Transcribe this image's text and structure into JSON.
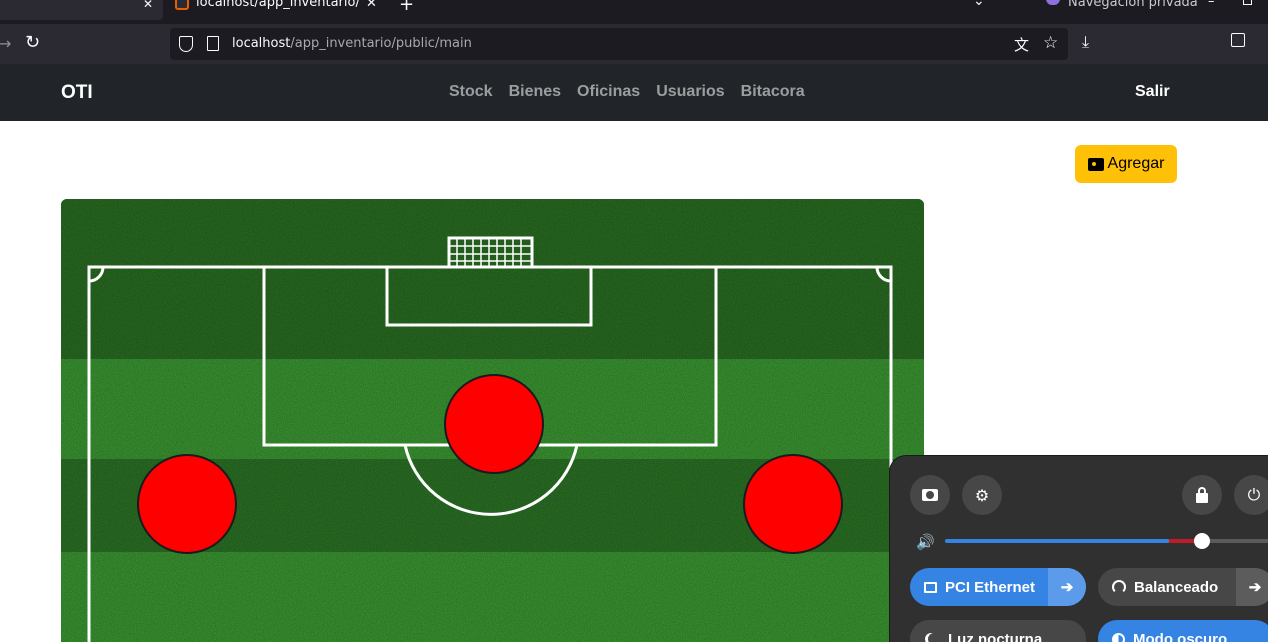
{
  "browser": {
    "tab_active_title": "localhost/app_inventario/public/main",
    "private_label": "Navegación privada",
    "url_host": "localhost",
    "url_path": "/app_inventario/public/main"
  },
  "site": {
    "brand": "OTI",
    "menu": [
      {
        "label": "Stock"
      },
      {
        "label": "Bienes"
      },
      {
        "label": "Oficinas"
      },
      {
        "label": "Usuarios"
      },
      {
        "label": "Bitacora"
      }
    ],
    "logout": "Salir",
    "add_button": "Agregar"
  },
  "field": {
    "players": 3,
    "player_color": "#ff0000",
    "grass_colors": [
      "#2f7d28",
      "#3aa032"
    ]
  },
  "quick_settings": {
    "volume_percent": 78,
    "toggles": [
      {
        "label": "PCI Ethernet",
        "active": true,
        "icon": "ethernet-icon"
      },
      {
        "label": "Balanceado",
        "active": false,
        "icon": "power-profile-icon"
      },
      {
        "label": "Luz nocturna",
        "active": false,
        "icon": "night-light-icon"
      },
      {
        "label": "Modo oscuro",
        "active": true,
        "icon": "dark-mode-icon"
      }
    ],
    "accent": "#3584e4"
  }
}
